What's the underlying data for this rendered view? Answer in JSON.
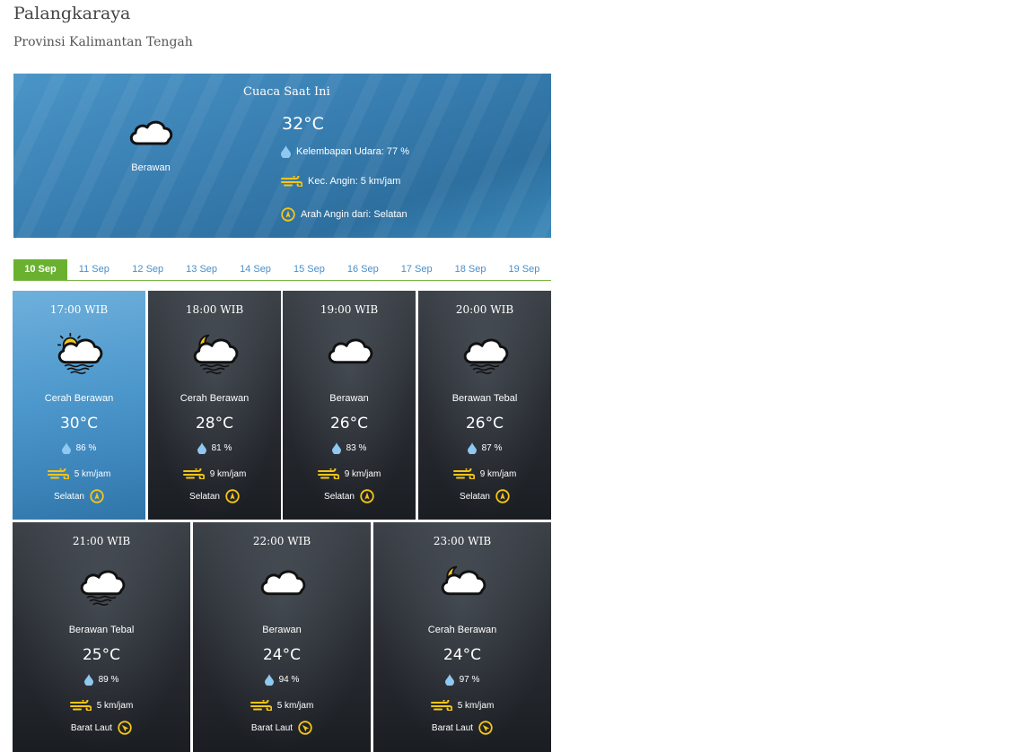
{
  "location": {
    "city": "Palangkaraya",
    "province": "Provinsi Kalimantan Tengah"
  },
  "current": {
    "title": "Cuaca Saat Ini",
    "icon": "cloud-icon",
    "condition": "Berawan",
    "temperature": "32°C",
    "humidity": "Kelembapan Udara: 77 %",
    "wind_speed": "Kec. Angin: 5 km/jam",
    "wind_direction": "Arah Angin dari: Selatan"
  },
  "tabs": [
    "10 Sep",
    "11 Sep",
    "12 Sep",
    "13 Sep",
    "14 Sep",
    "15 Sep",
    "16 Sep",
    "17 Sep",
    "18 Sep",
    "19 Sep"
  ],
  "active_tab": "10 Sep",
  "forecast": [
    {
      "time": "17:00 WIB",
      "icon": "sun-cloud-fog-icon",
      "condition": "Cerah Berawan",
      "temp": "30°C",
      "humidity": "86 %",
      "wind": "5 km/jam",
      "direction": "Selatan"
    },
    {
      "time": "18:00 WIB",
      "icon": "moon-cloud-fog-icon",
      "condition": "Cerah Berawan",
      "temp": "28°C",
      "humidity": "81 %",
      "wind": "9 km/jam",
      "direction": "Selatan"
    },
    {
      "time": "19:00 WIB",
      "icon": "cloud-icon",
      "condition": "Berawan",
      "temp": "26°C",
      "humidity": "83 %",
      "wind": "9 km/jam",
      "direction": "Selatan"
    },
    {
      "time": "20:00 WIB",
      "icon": "cloud-fog-icon",
      "condition": "Berawan Tebal",
      "temp": "26°C",
      "humidity": "87 %",
      "wind": "9 km/jam",
      "direction": "Selatan"
    },
    {
      "time": "21:00 WIB",
      "icon": "cloud-fog-icon",
      "condition": "Berawan Tebal",
      "temp": "25°C",
      "humidity": "89 %",
      "wind": "5 km/jam",
      "direction": "Barat Laut"
    },
    {
      "time": "22:00 WIB",
      "icon": "cloud-icon",
      "condition": "Berawan",
      "temp": "24°C",
      "humidity": "94 %",
      "wind": "5 km/jam",
      "direction": "Barat Laut"
    },
    {
      "time": "23:00 WIB",
      "icon": "moon-cloud-icon",
      "condition": "Cerah Berawan",
      "temp": "24°C",
      "humidity": "97 %",
      "wind": "5 km/jam",
      "direction": "Barat Laut"
    }
  ],
  "colors": {
    "accent_green": "#6ab130",
    "tab_text": "#4a8fc7",
    "icon_yellow": "#f5c518",
    "drop_blue": "#8fc8f0"
  }
}
